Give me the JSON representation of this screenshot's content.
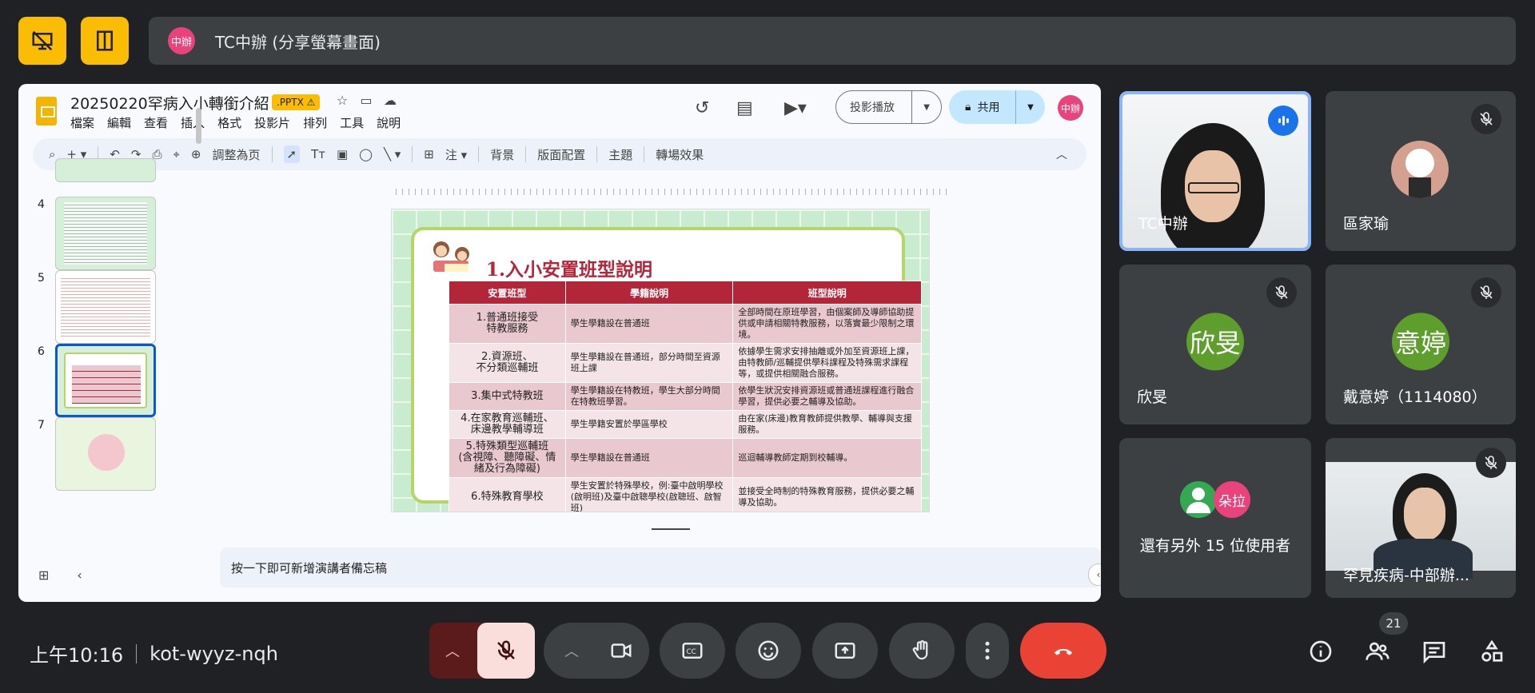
{
  "presenter_bar": {
    "avatar_initials": "中辦",
    "text": "TC中辦 (分享螢幕畫面)"
  },
  "slides_app": {
    "doc_title": "20250220罕病入小轉銜介紹",
    "file_badge": ".PPTX ⚠",
    "menu": [
      "檔案",
      "編輯",
      "查看",
      "插入",
      "格式",
      "投影片",
      "排列",
      "工具",
      "說明"
    ],
    "slideshow_label": "投影播放",
    "share_label": "共用",
    "user_initials": "中辦",
    "toolbar": {
      "zoom_label": "調整為⻚",
      "background": "背景",
      "layout": "版面配置",
      "theme": "主題",
      "transition": "轉場效果"
    },
    "filmstrip_numbers": [
      "4",
      "5",
      "6",
      "7"
    ],
    "notes_placeholder": "按一下即可新增演講者備忘稿"
  },
  "slide": {
    "title": "1.入小安置班型說明",
    "headers": [
      "安置班型",
      "學籍說明",
      "班型說明"
    ],
    "rows": [
      [
        "1.普通班接受\n特教服務",
        "學生學籍設在普通班",
        "全部時間在原班學習，由個案師及導師協助提供或申請相關特教服務，以落實最少限制之環境。"
      ],
      [
        "2.資源班、\n不分類巡輔班",
        "學生學籍設在普通班，部分時間至資源班上課",
        "依據學生需求安排抽離或外加至資源班上課，由特教師/巡輔提供學科課程及特殊需求課程等，或提供相關融合服務。"
      ],
      [
        "3.集中式特教班",
        "學生學籍設在特教班，學生大部分時間在特教班學習。",
        "依學生狀況安排資源班或普通班課程進行融合學習，提供必要之輔導及協助。"
      ],
      [
        "4.在家教育巡輔班、\n床邊教學輔導班",
        "學生學籍安置於學區學校",
        "由在家(床邊)教育教師提供教學、輔導與支援服務。"
      ],
      [
        "5.特殊類型巡輔班\n(含視障、聽障礙、情緒及行為障礙)",
        "學生學籍設在普通班",
        "巡迴輔導教師定期到校輔導。"
      ],
      [
        "6.特殊教育學校",
        "學生安置於特殊學校，例:臺中啟明學校(啟明班)及臺中啟聰學校(啟聰班、啟智班)",
        "並接受全時制的特殊教育服務，提供必要之輔導及協助。"
      ]
    ]
  },
  "participants": {
    "tc_office": "TC中辦",
    "ou_jiayu": "區家瑜",
    "xinyun_avatar": "欣旻",
    "xinyun": "欣旻",
    "yiting_avatar": "意婷",
    "yiting": "戴意婷（1114080）",
    "others_label": "還有另外 15 位使用者",
    "others_avatar2": "朵拉",
    "rare_disease": "罕見疾病-中部辦..."
  },
  "bottom": {
    "time": "上午10:16",
    "meeting_code": "kot-wyyz-nqh",
    "participant_count": "21"
  },
  "colors": {
    "accent_yellow": "#fbbc04",
    "end_call_red": "#ea4335",
    "slide_title_red": "#b3263a",
    "active_blue": "#8ab4f8"
  }
}
